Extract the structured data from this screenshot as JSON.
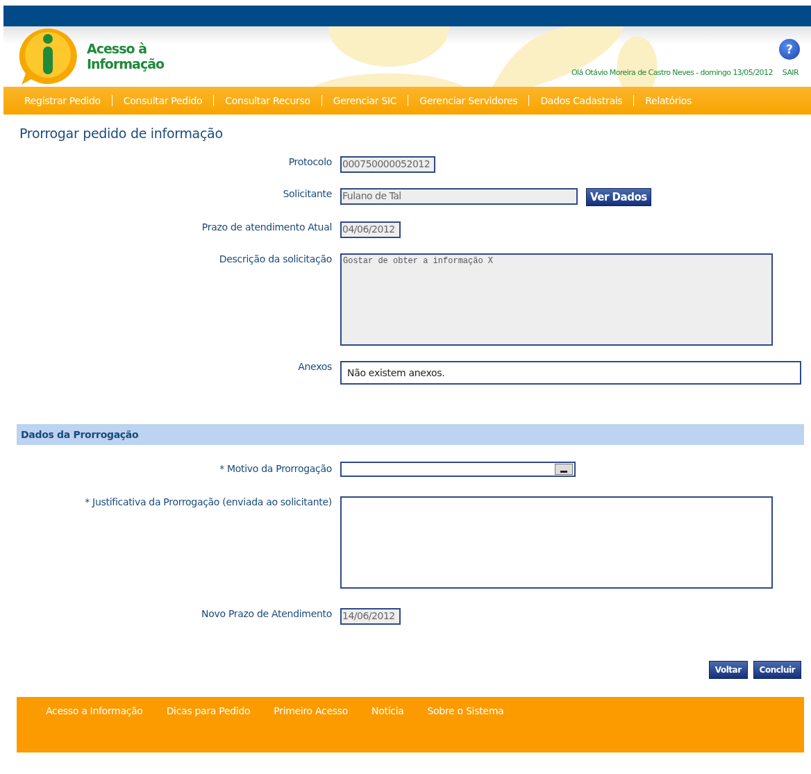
{
  "header": {
    "logo_text": [
      "Acesso à",
      "Informação"
    ],
    "help": "?",
    "greeting": "Olá Otávio Moreira de Castro Neves - domingo 13/05/2012",
    "logout": "SAIR"
  },
  "nav": [
    "Registrar Pedido",
    "Consultar Pedido",
    "Consultar Recurso",
    "Gerenciar SIC",
    "Gerenciar Servidores",
    "Dados Cadastrais",
    "Relatórios"
  ],
  "page_title": "Prorrogar pedido de informação",
  "fields": [
    {
      "kind": "input",
      "label": "Protocolo",
      "value": "000750000052012"
    },
    {
      "kind": "wide_input",
      "label": "Solicitante",
      "value": "Fulano de Tal",
      "button": "Ver Dados"
    },
    {
      "kind": "input",
      "label": "Prazo de atendimento Atual",
      "value": "04/06/2012"
    },
    {
      "kind": "textarea",
      "label": "Descrição da solicitação",
      "value": "Gostar de obter a informação X",
      "disabled": true
    },
    {
      "kind": "box",
      "label": "Anexos",
      "value": "Não existem anexos."
    }
  ],
  "section": "Dados da Prorrogação",
  "extension_fields": [
    {
      "kind": "select",
      "label": "* Motivo da Prorrogação"
    },
    {
      "kind": "textarea",
      "label": "* Justificativa da Prorrogação (enviada ao solicitante)",
      "disabled": false
    },
    {
      "kind": "input",
      "label": "Novo Prazo de Atendimento",
      "value": "14/06/2012"
    }
  ],
  "buttons": [
    "Voltar",
    "Concluir"
  ],
  "footer": [
    "Acesso a Informação",
    "Dicas para Pedido",
    "Primeiro Acesso",
    "Notícia",
    "Sobre o Sistema"
  ]
}
